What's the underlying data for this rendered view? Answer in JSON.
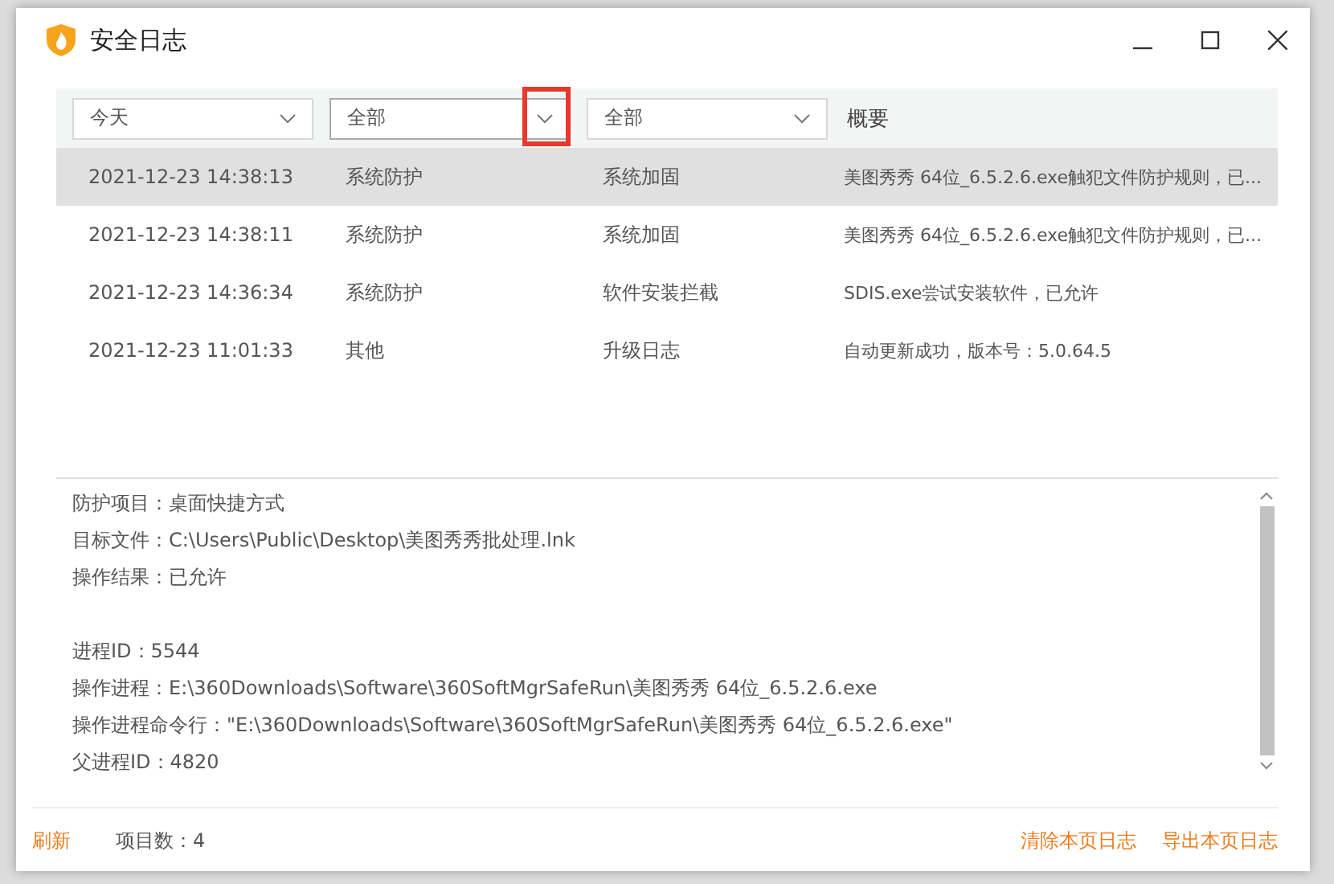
{
  "window": {
    "title": "安全日志"
  },
  "filters": [
    {
      "value": "今天"
    },
    {
      "value": "全部"
    },
    {
      "value": "全部"
    }
  ],
  "summary_header": "概要",
  "rows": [
    {
      "time": "2021-12-23 14:38:13",
      "type": "系统防护",
      "category": "系统加固",
      "summary": "美图秀秀 64位_6.5.2.6.exe触犯文件防护规则，已...",
      "selected": true
    },
    {
      "time": "2021-12-23 14:38:11",
      "type": "系统防护",
      "category": "系统加固",
      "summary": "美图秀秀 64位_6.5.2.6.exe触犯文件防护规则，已...",
      "selected": false
    },
    {
      "time": "2021-12-23 14:36:34",
      "type": "系统防护",
      "category": "软件安装拦截",
      "summary": "SDIS.exe尝试安装软件，已允许",
      "selected": false
    },
    {
      "time": "2021-12-23 11:01:33",
      "type": "其他",
      "category": "升级日志",
      "summary": "自动更新成功，版本号：5.0.64.5",
      "selected": false
    }
  ],
  "details": [
    [
      "防护项目：桌面快捷方式",
      "目标文件：C:\\Users\\Public\\Desktop\\美图秀秀批处理.lnk",
      "操作结果：已允许"
    ],
    [
      "进程ID：5544",
      "操作进程：E:\\360Downloads\\Software\\360SoftMgrSafeRun\\美图秀秀 64位_6.5.2.6.exe",
      "操作进程命令行：\"E:\\360Downloads\\Software\\360SoftMgrSafeRun\\美图秀秀 64位_6.5.2.6.exe\"",
      "父进程ID：4820"
    ]
  ],
  "footer": {
    "refresh": "刷新",
    "item_count": "项目数：4",
    "clear": "清除本页日志",
    "export": "导出本页日志"
  }
}
